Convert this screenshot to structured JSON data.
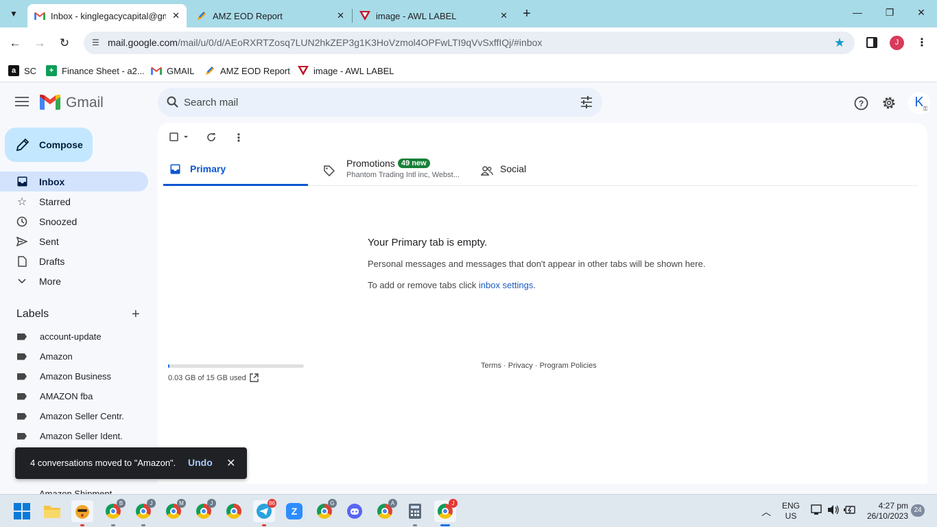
{
  "browser": {
    "tabs": [
      {
        "title": "Inbox - kinglegacycapital@gmail.com",
        "active": true,
        "favicon": "gmail-icon"
      },
      {
        "title": "AMZ EOD Report",
        "active": false,
        "favicon": "pencil-doc-icon"
      },
      {
        "title": "image - AWL LABEL",
        "active": false,
        "favicon": "awl-logo-icon"
      }
    ],
    "close_glyph": "✕",
    "new_tab_glyph": "+",
    "url_host": "mail.google.com",
    "url_path": "/mail/u/0/d/AEoRXRTZosq7LUN2hkZEP3g1K3HoVzmol4OPFwLTI9qVvSxffIQj/#inbox",
    "profile_initial": "J",
    "bookmarks": [
      {
        "label": "SC",
        "icon": "amazon-icon"
      },
      {
        "label": "Finance Sheet - a2...",
        "icon": "sheets-icon"
      },
      {
        "label": "GMAIL",
        "icon": "gmail-icon"
      },
      {
        "label": "AMZ EOD Report",
        "icon": "pencil-doc-icon"
      },
      {
        "label": "image - AWL LABEL",
        "icon": "awl-logo-icon"
      }
    ]
  },
  "gmail": {
    "brand": "Gmail",
    "search_placeholder": "Search mail",
    "account_initial": "K",
    "compose_label": "Compose",
    "nav": [
      {
        "label": "Inbox",
        "icon": "inbox-icon",
        "active": true
      },
      {
        "label": "Starred",
        "icon": "star-icon"
      },
      {
        "label": "Snoozed",
        "icon": "clock-icon"
      },
      {
        "label": "Sent",
        "icon": "send-icon"
      },
      {
        "label": "Drafts",
        "icon": "draft-icon"
      },
      {
        "label": "More",
        "icon": "chevron-down-icon"
      }
    ],
    "labels_heading": "Labels",
    "labels": [
      "account-update",
      "Amazon",
      "Amazon Business",
      "AMAZON fba",
      "Amazon Seller Centr.",
      "Amazon Seller Ident."
    ],
    "partially_hidden_label": "Amazon Shipment",
    "tabs": {
      "primary": "Primary",
      "promotions": "Promotions",
      "promotions_badge": "49 new",
      "promotions_senders": "Phantom Trading Intl inc, Webst...",
      "social": "Social"
    },
    "empty": {
      "title": "Your Primary tab is empty.",
      "line1": "Personal messages and messages that don't appear in other tabs will be shown here.",
      "line2_prefix": "To add or remove tabs click ",
      "line2_link": "inbox settings",
      "line2_suffix": "."
    },
    "storage": {
      "text": "0.03 GB of 15 GB used",
      "used_gb": 0.03,
      "total_gb": 15
    },
    "footer": {
      "terms": "Terms",
      "privacy": "Privacy",
      "policies": "Program Policies",
      "separator": " · "
    },
    "snackbar": {
      "message": "4 conversations moved to \"Amazon\".",
      "undo": "Undo"
    }
  },
  "taskbar": {
    "apps": [
      {
        "name": "start-icon"
      },
      {
        "name": "file-explorer-icon"
      },
      {
        "name": "game-app-icon"
      },
      {
        "name": "chrome-icon",
        "badge": "B"
      },
      {
        "name": "chrome-icon",
        "badge": "J"
      },
      {
        "name": "chrome-icon",
        "badge": "M"
      },
      {
        "name": "chrome-icon",
        "badge": "J"
      },
      {
        "name": "chrome-icon",
        "badge": ""
      },
      {
        "name": "telegram-icon",
        "badge": "86"
      },
      {
        "name": "zoom-icon"
      },
      {
        "name": "chrome-icon",
        "badge": "G"
      },
      {
        "name": "discord-icon"
      },
      {
        "name": "chrome-icon",
        "badge": "A"
      },
      {
        "name": "calculator-icon"
      },
      {
        "name": "chrome-icon",
        "badge": "J"
      }
    ],
    "lang_top": "ENG",
    "lang_bottom": "US",
    "time": "4:27 pm",
    "date": "26/10/2023",
    "notifications": "24"
  },
  "colors": {
    "tabstrip": "#a8dbe8",
    "compose": "#c2e7ff",
    "active_nav": "#d3e3fd",
    "primary_accent": "#0b57d0",
    "promo_badge": "#188038"
  }
}
